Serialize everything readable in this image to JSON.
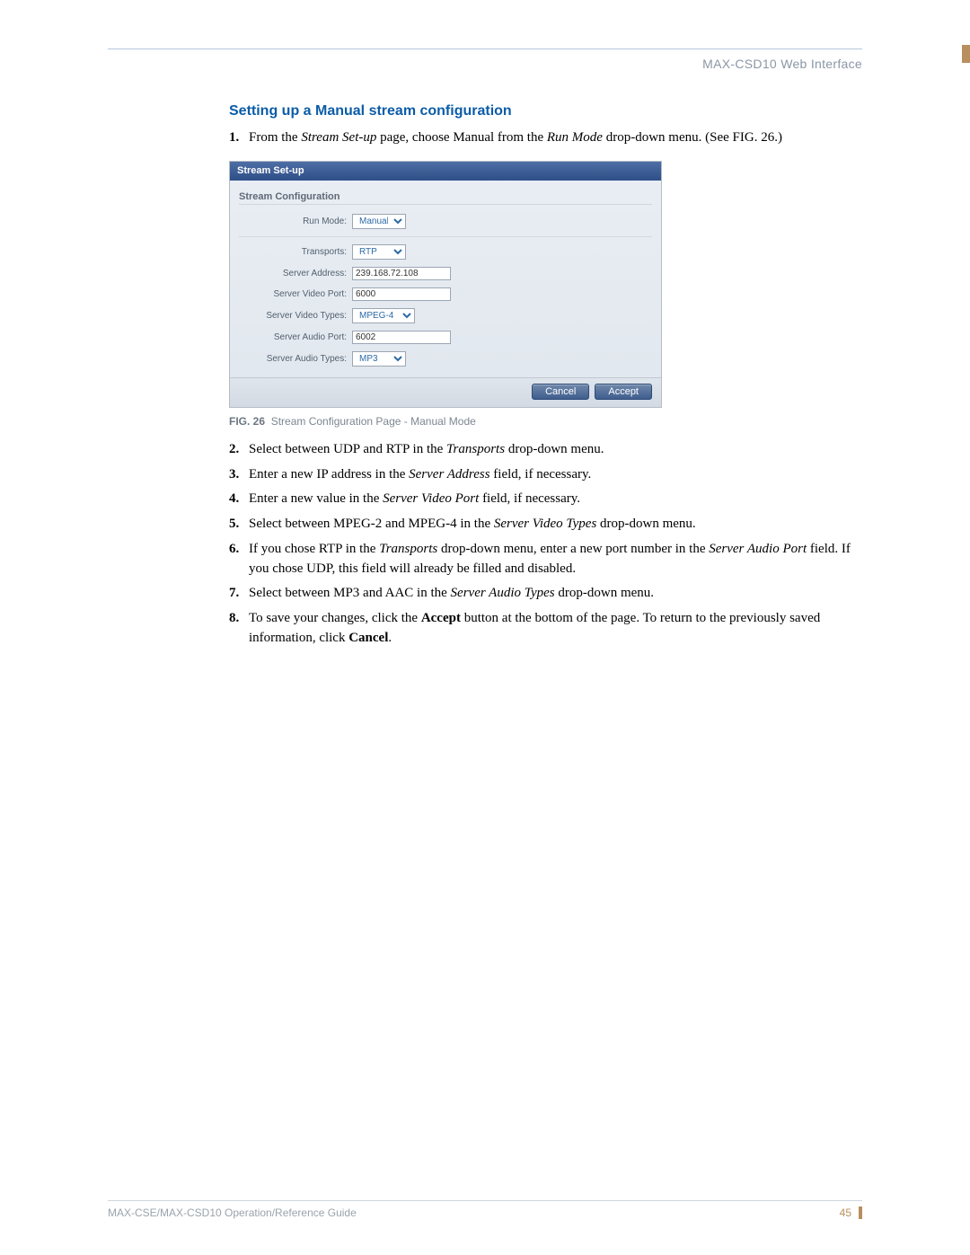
{
  "header": {
    "title": "MAX-CSD10 Web Interface"
  },
  "section": {
    "heading": "Setting up a Manual stream configuration"
  },
  "steps": [
    {
      "n": "1.",
      "pre": "From the ",
      "i1": "Stream Set-up",
      "mid": " page, choose Manual from the ",
      "i2": "Run Mode",
      "post": " drop-down menu. (See FIG. 26.)"
    },
    {
      "n": "2.",
      "pre": "Select between UDP and RTP in the ",
      "i1": "Transports",
      "post": " drop-down menu."
    },
    {
      "n": "3.",
      "pre": "Enter a new IP address in the ",
      "i1": "Server Address",
      "post": " field, if necessary."
    },
    {
      "n": "4.",
      "pre": "Enter a new value in the ",
      "i1": "Server Video Port",
      "post": " field, if necessary."
    },
    {
      "n": "5.",
      "pre": "Select between MPEG-2 and MPEG-4 in the ",
      "i1": "Server Video Types",
      "post": " drop-down menu."
    },
    {
      "n": "6.",
      "pre": "If you chose RTP in the ",
      "i1": "Transports",
      "mid": " drop-down menu, enter a new port number in the ",
      "i2": "Server Audio Port",
      "post": " field. If you chose UDP, this field will already be filled and disabled."
    },
    {
      "n": "7.",
      "pre": "Select between MP3 and AAC in the ",
      "i1": "Server Audio Types",
      "post": " drop-down menu."
    },
    {
      "n": "8.",
      "pre": "To save your changes, click the ",
      "b1": "Accept",
      "mid": " button at the bottom of the page. To return to the previously saved information, click ",
      "b2": "Cancel",
      "post": "."
    }
  ],
  "figure": {
    "label": "FIG. 26",
    "caption": "Stream Configuration Page - Manual Mode",
    "window_title": "Stream Set-up",
    "group_title": "Stream Configuration",
    "labels": {
      "run_mode": "Run Mode:",
      "transports": "Transports:",
      "server_address": "Server Address:",
      "server_video_port": "Server Video Port:",
      "server_video_types": "Server Video Types:",
      "server_audio_port": "Server Audio Port:",
      "server_audio_types": "Server Audio Types:"
    },
    "values": {
      "run_mode": "Manual",
      "transports": "RTP",
      "server_address": "239.168.72.108",
      "server_video_port": "6000",
      "server_video_types": "MPEG-4",
      "server_audio_port": "6002",
      "server_audio_types": "MP3"
    },
    "buttons": {
      "cancel": "Cancel",
      "accept": "Accept"
    }
  },
  "footer": {
    "guide": "MAX-CSE/MAX-CSD10 Operation/Reference Guide",
    "page": "45"
  }
}
